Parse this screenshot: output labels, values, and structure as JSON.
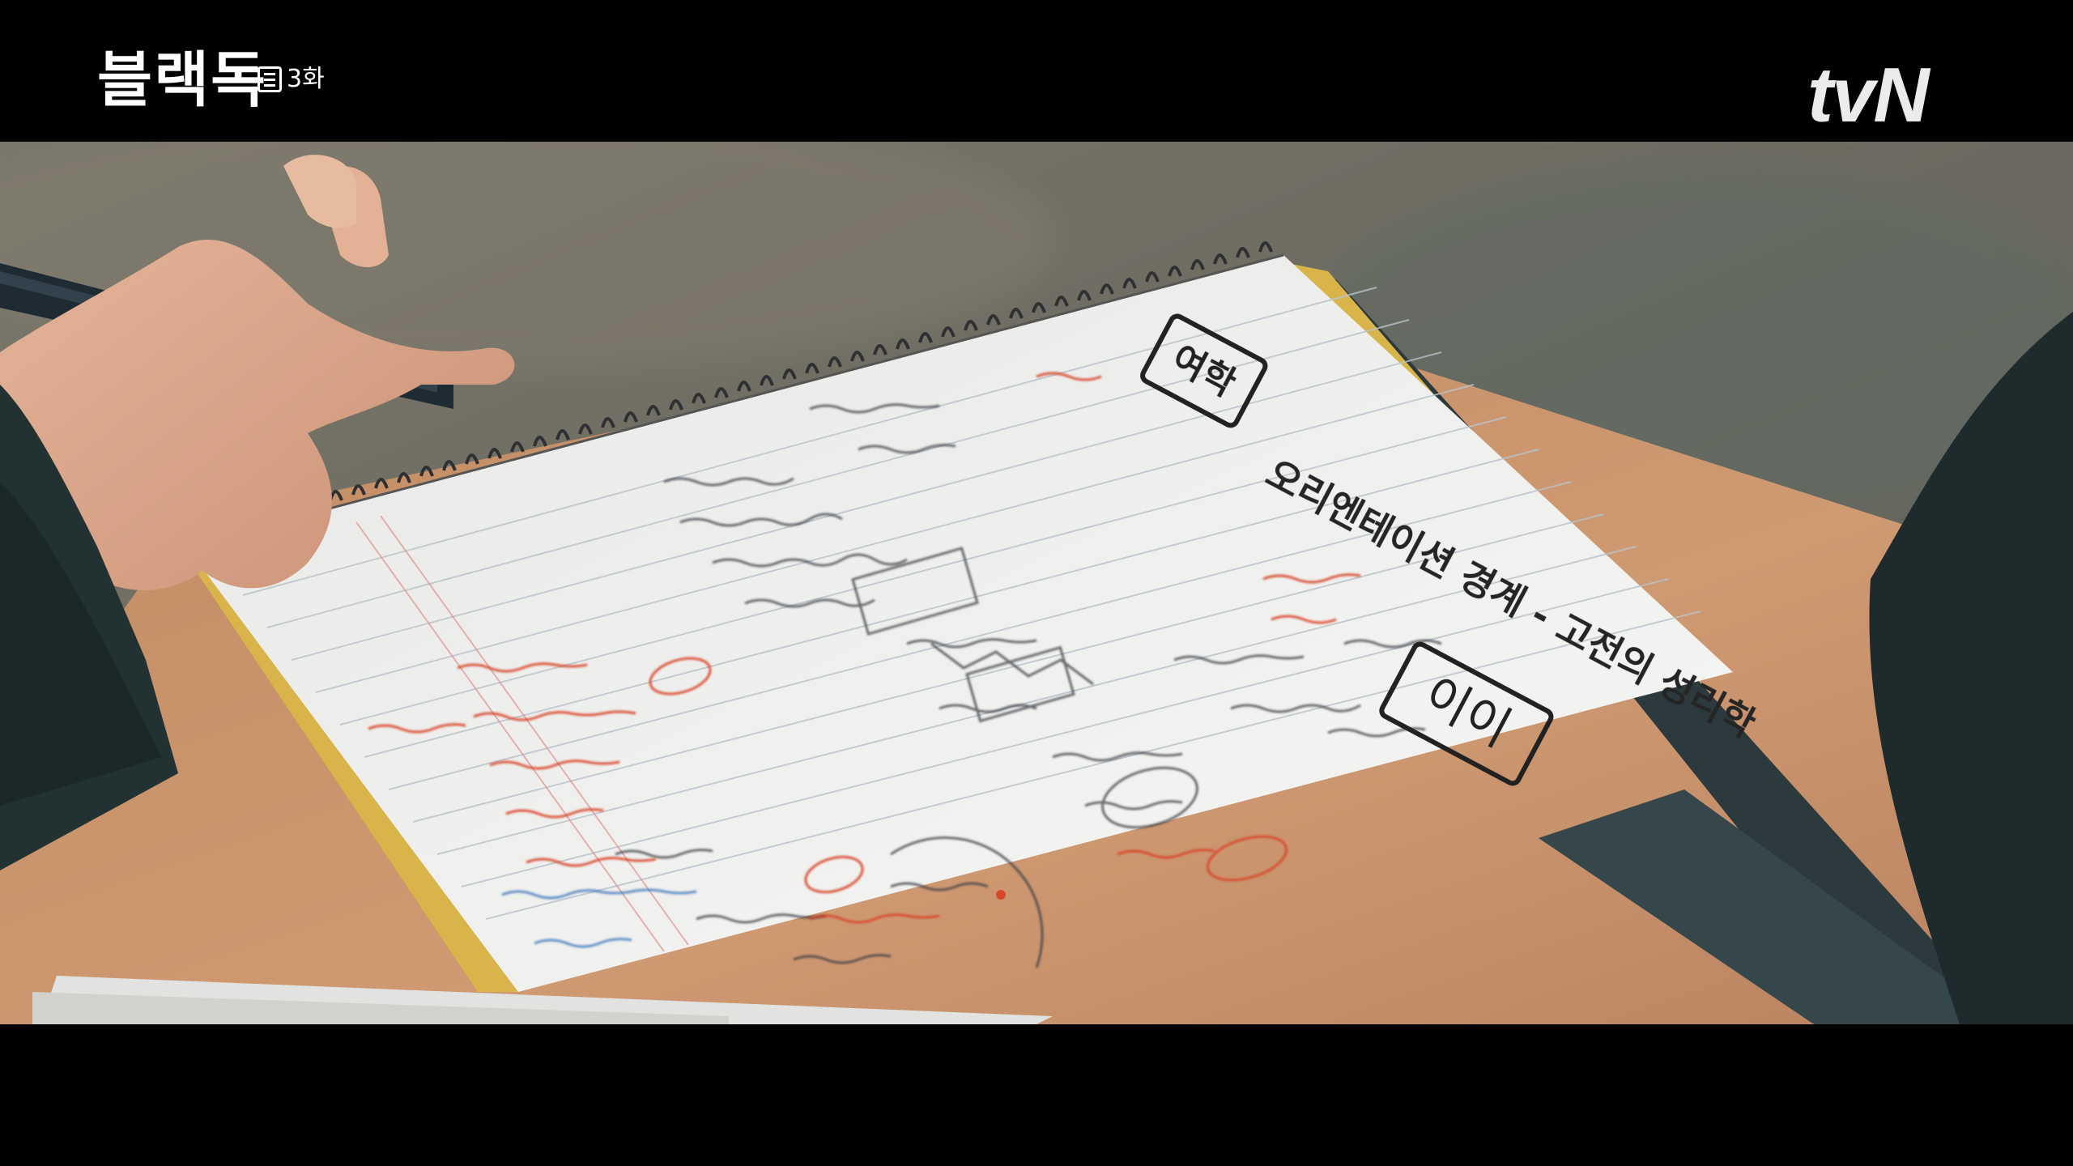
{
  "overlay": {
    "show_title": "블랙독",
    "episode": "3화",
    "channel": "tvN"
  },
  "notebook": {
    "heading": "오리엔테이션 경계 - 고전의 성리학",
    "boxed_label_left": "여학",
    "boxed_label_right": "이이"
  },
  "colors": {
    "letterbox": "#000000",
    "background": "#6e6c62",
    "desk": "#c9926a",
    "paper": "#f1f1ef",
    "red_ink": "#d9472b",
    "blue_ink": "#4a7fc0",
    "tray": "#2f3a3c"
  }
}
